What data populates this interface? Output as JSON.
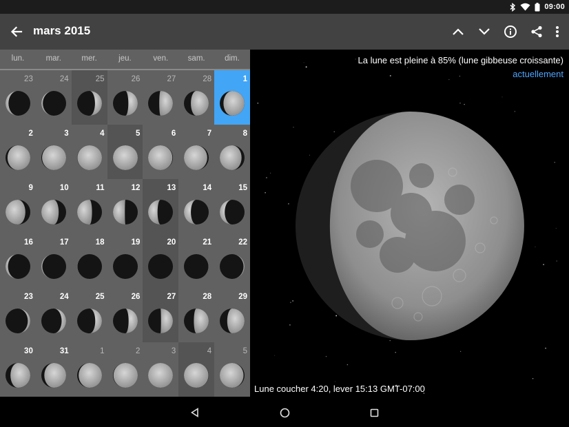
{
  "status_bar": {
    "time": "09:00",
    "icons": [
      "bluetooth-icon",
      "wifi-icon",
      "battery-icon"
    ]
  },
  "app_bar": {
    "title": "mars 2015",
    "actions": [
      "previous-month",
      "next-month",
      "info",
      "share",
      "more-options"
    ]
  },
  "weekdays": [
    "lun.",
    "mar.",
    "mer.",
    "jeu.",
    "ven.",
    "sam.",
    "dim."
  ],
  "days": [
    {
      "day": "23",
      "lit": 0.12,
      "waxing": false,
      "current": false,
      "shaded": false
    },
    {
      "day": "24",
      "lit": 0.06,
      "waxing": false,
      "current": false,
      "shaded": false
    },
    {
      "day": "25",
      "lit": 0.28,
      "waxing": true,
      "current": false,
      "shaded": true
    },
    {
      "day": "26",
      "lit": 0.38,
      "waxing": true,
      "current": false,
      "shaded": false
    },
    {
      "day": "27",
      "lit": 0.55,
      "waxing": true,
      "current": false,
      "shaded": false
    },
    {
      "day": "28",
      "lit": 0.72,
      "waxing": true,
      "current": false,
      "shaded": false
    },
    {
      "day": "1",
      "lit": 0.85,
      "waxing": true,
      "current": true,
      "shaded": false,
      "selected": true
    },
    {
      "day": "2",
      "lit": 0.92,
      "waxing": true,
      "current": true,
      "shaded": false
    },
    {
      "day": "3",
      "lit": 0.97,
      "waxing": true,
      "current": true,
      "shaded": false
    },
    {
      "day": "4",
      "lit": 0.99,
      "waxing": true,
      "current": true,
      "shaded": false
    },
    {
      "day": "5",
      "lit": 1.0,
      "waxing": true,
      "current": true,
      "shaded": true
    },
    {
      "day": "6",
      "lit": 0.98,
      "waxing": false,
      "current": true,
      "shaded": false
    },
    {
      "day": "7",
      "lit": 0.94,
      "waxing": false,
      "current": true,
      "shaded": false
    },
    {
      "day": "8",
      "lit": 0.88,
      "waxing": false,
      "current": true,
      "shaded": false
    },
    {
      "day": "9",
      "lit": 0.8,
      "waxing": false,
      "current": true,
      "shaded": false
    },
    {
      "day": "10",
      "lit": 0.7,
      "waxing": false,
      "current": true,
      "shaded": false
    },
    {
      "day": "11",
      "lit": 0.6,
      "waxing": false,
      "current": true,
      "shaded": false
    },
    {
      "day": "12",
      "lit": 0.48,
      "waxing": false,
      "current": true,
      "shaded": false
    },
    {
      "day": "13",
      "lit": 0.38,
      "waxing": false,
      "current": true,
      "shaded": true
    },
    {
      "day": "14",
      "lit": 0.28,
      "waxing": false,
      "current": true,
      "shaded": false
    },
    {
      "day": "15",
      "lit": 0.2,
      "waxing": false,
      "current": true,
      "shaded": false
    },
    {
      "day": "16",
      "lit": 0.1,
      "waxing": false,
      "current": true,
      "shaded": false
    },
    {
      "day": "17",
      "lit": 0.04,
      "waxing": false,
      "current": true,
      "shaded": false
    },
    {
      "day": "18",
      "lit": 0.01,
      "waxing": false,
      "current": true,
      "shaded": false
    },
    {
      "day": "19",
      "lit": 0.0,
      "waxing": true,
      "current": true,
      "shaded": false
    },
    {
      "day": "20",
      "lit": 0.0,
      "waxing": true,
      "current": true,
      "shaded": true
    },
    {
      "day": "21",
      "lit": 0.01,
      "waxing": true,
      "current": true,
      "shaded": false
    },
    {
      "day": "22",
      "lit": 0.04,
      "waxing": true,
      "current": true,
      "shaded": false
    },
    {
      "day": "23",
      "lit": 0.1,
      "waxing": true,
      "current": true,
      "shaded": false
    },
    {
      "day": "24",
      "lit": 0.18,
      "waxing": true,
      "current": true,
      "shaded": false
    },
    {
      "day": "25",
      "lit": 0.27,
      "waxing": true,
      "current": true,
      "shaded": false
    },
    {
      "day": "26",
      "lit": 0.37,
      "waxing": true,
      "current": true,
      "shaded": false
    },
    {
      "day": "27",
      "lit": 0.48,
      "waxing": true,
      "current": true,
      "shaded": true
    },
    {
      "day": "28",
      "lit": 0.6,
      "waxing": true,
      "current": true,
      "shaded": false
    },
    {
      "day": "29",
      "lit": 0.7,
      "waxing": true,
      "current": true,
      "shaded": false
    },
    {
      "day": "30",
      "lit": 0.8,
      "waxing": true,
      "current": true,
      "shaded": false
    },
    {
      "day": "31",
      "lit": 0.88,
      "waxing": true,
      "current": true,
      "shaded": false
    },
    {
      "day": "1",
      "lit": 0.94,
      "waxing": true,
      "current": false,
      "shaded": false
    },
    {
      "day": "2",
      "lit": 0.98,
      "waxing": true,
      "current": false,
      "shaded": false
    },
    {
      "day": "3",
      "lit": 1.0,
      "waxing": true,
      "current": false,
      "shaded": false
    },
    {
      "day": "4",
      "lit": 0.99,
      "waxing": false,
      "current": false,
      "shaded": true
    },
    {
      "day": "5",
      "lit": 0.96,
      "waxing": false,
      "current": false,
      "shaded": false
    }
  ],
  "detail": {
    "phase_text": "La lune est pleine à 85% (lune gibbeuse croissante)",
    "now_link": "actuellement",
    "moon_lit_fraction": 0.85,
    "moon_waxing": true,
    "times_text": "Lune coucher 4:20, lever 15:13 GMT-07:00"
  },
  "colors": {
    "app_bar": "#424242",
    "calendar_bg": "#616161",
    "selected_day": "#42a5f5",
    "link": "#4fa3ff"
  },
  "nav_bar": [
    "back-icon",
    "home-icon",
    "recents-icon"
  ]
}
